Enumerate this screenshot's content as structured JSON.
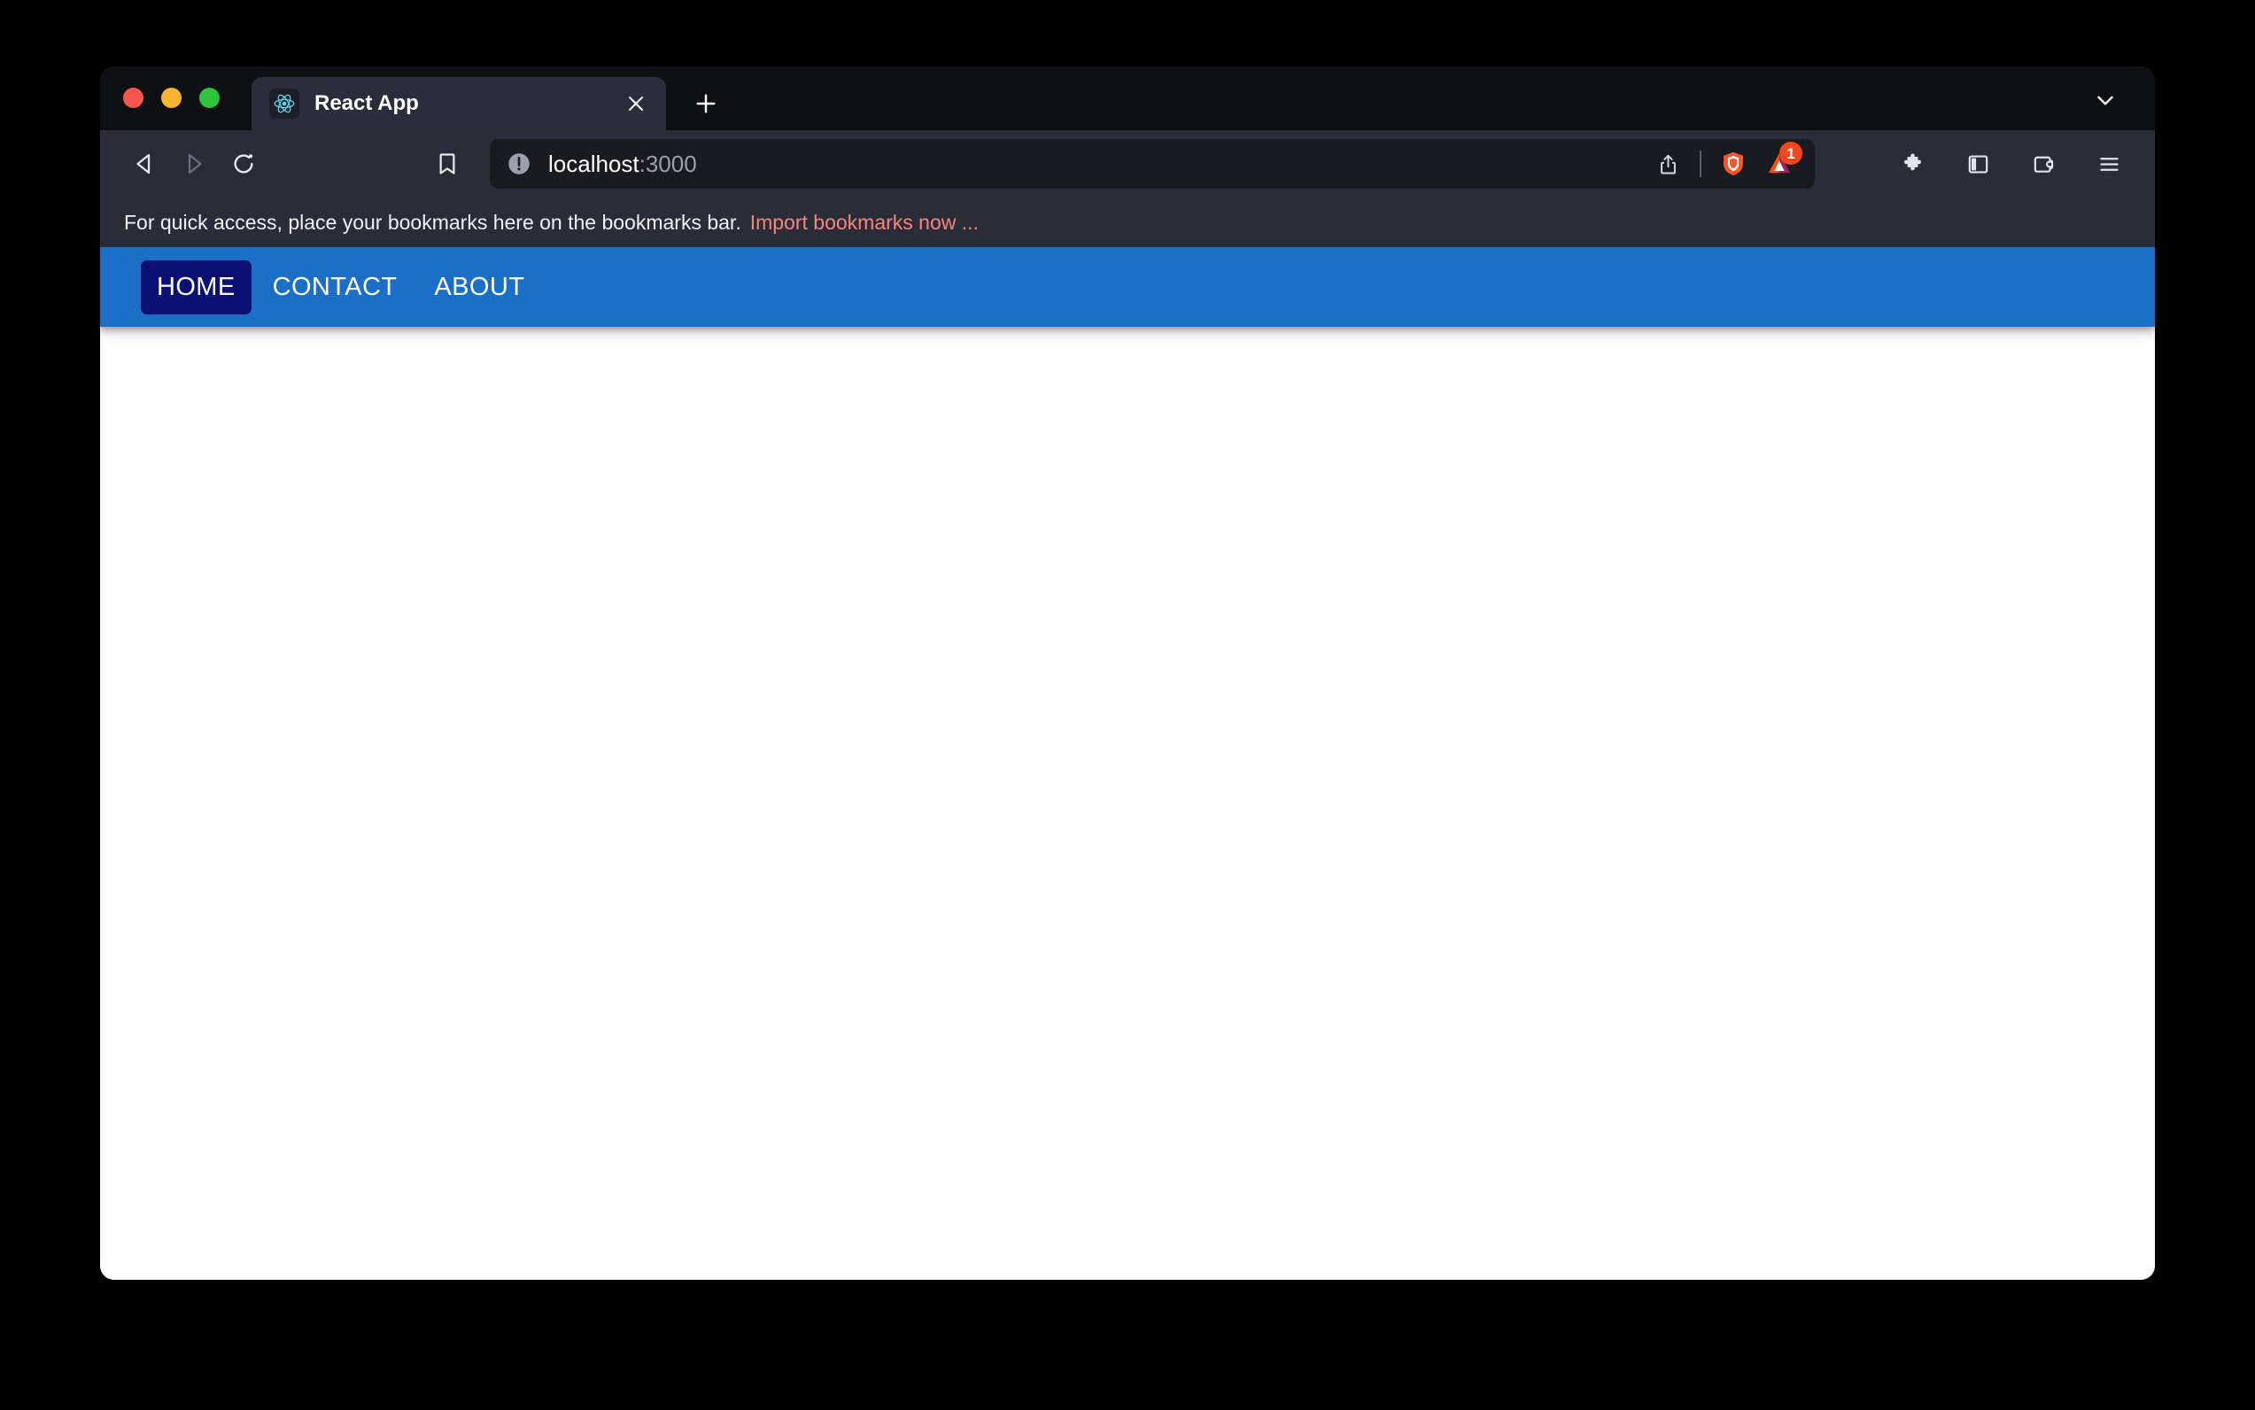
{
  "window": {
    "traffic_lights": [
      {
        "name": "close",
        "color": "#f9554f"
      },
      {
        "name": "minimize",
        "color": "#fbb430"
      },
      {
        "name": "maximize",
        "color": "#2fc23f"
      }
    ]
  },
  "tab_strip": {
    "tabs": [
      {
        "title": "React App",
        "favicon": "react-logo-icon",
        "close_label": "×"
      }
    ],
    "new_tab_label": "+",
    "list_all_tabs_icon": "chevron-down-icon"
  },
  "toolbar": {
    "back_icon": "back-arrow-icon",
    "forward_icon": "forward-arrow-icon",
    "reload_icon": "reload-icon",
    "bookmark_icon": "bookmark-icon",
    "url": {
      "security_icon": "not-secure-info-icon",
      "host": "localhost",
      "port": ":3000"
    },
    "url_actions": [
      {
        "name": "share-icon"
      },
      {
        "name": "brave-shields-icon"
      },
      {
        "name": "brave-rewards-icon",
        "badge": "1"
      }
    ],
    "right_icons": [
      {
        "name": "extensions-puzzle-icon"
      },
      {
        "name": "sidebar-panel-icon"
      },
      {
        "name": "wallet-icon"
      },
      {
        "name": "hamburger-menu-icon"
      }
    ]
  },
  "bookmarks_bar": {
    "message": "For quick access, place your bookmarks here on the bookmarks bar.",
    "import_link": "Import bookmarks now ...",
    "link_color": "#f5877a"
  },
  "page": {
    "navbar": {
      "background": "#1b6fc7",
      "active_background": "#0a1172",
      "links": [
        {
          "label": "HOME",
          "active": true
        },
        {
          "label": "CONTACT",
          "active": false
        },
        {
          "label": "ABOUT",
          "active": false
        }
      ]
    },
    "content": ""
  }
}
